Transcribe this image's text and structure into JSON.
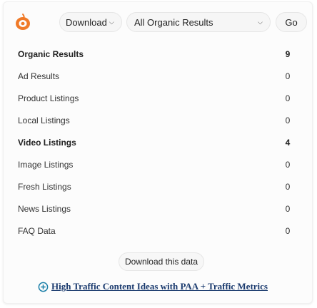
{
  "toolbar": {
    "logo_icon": "onion-logo-icon",
    "logo_color": "#f07a28",
    "download_label": "Download",
    "filter_selected": "All Organic Results",
    "go_label": "Go"
  },
  "results": [
    {
      "label": "Organic Results",
      "count": "9",
      "bold": true
    },
    {
      "label": "Ad Results",
      "count": "0",
      "bold": false
    },
    {
      "label": "Product Listings",
      "count": "0",
      "bold": false
    },
    {
      "label": "Local Listings",
      "count": "0",
      "bold": false
    },
    {
      "label": "Video Listings",
      "count": "4",
      "bold": true
    },
    {
      "label": "Image Listings",
      "count": "0",
      "bold": false
    },
    {
      "label": "Fresh Listings",
      "count": "0",
      "bold": false
    },
    {
      "label": "News Listings",
      "count": "0",
      "bold": false
    },
    {
      "label": "FAQ Data",
      "count": "0",
      "bold": false
    }
  ],
  "footer": {
    "download_data_label": "Download this data",
    "paa_link_label": "High Traffic Content Ideas with PAA + Traffic Metrics",
    "paa_icon": "plus-circle-icon",
    "link_color": "#1a3a6e"
  }
}
